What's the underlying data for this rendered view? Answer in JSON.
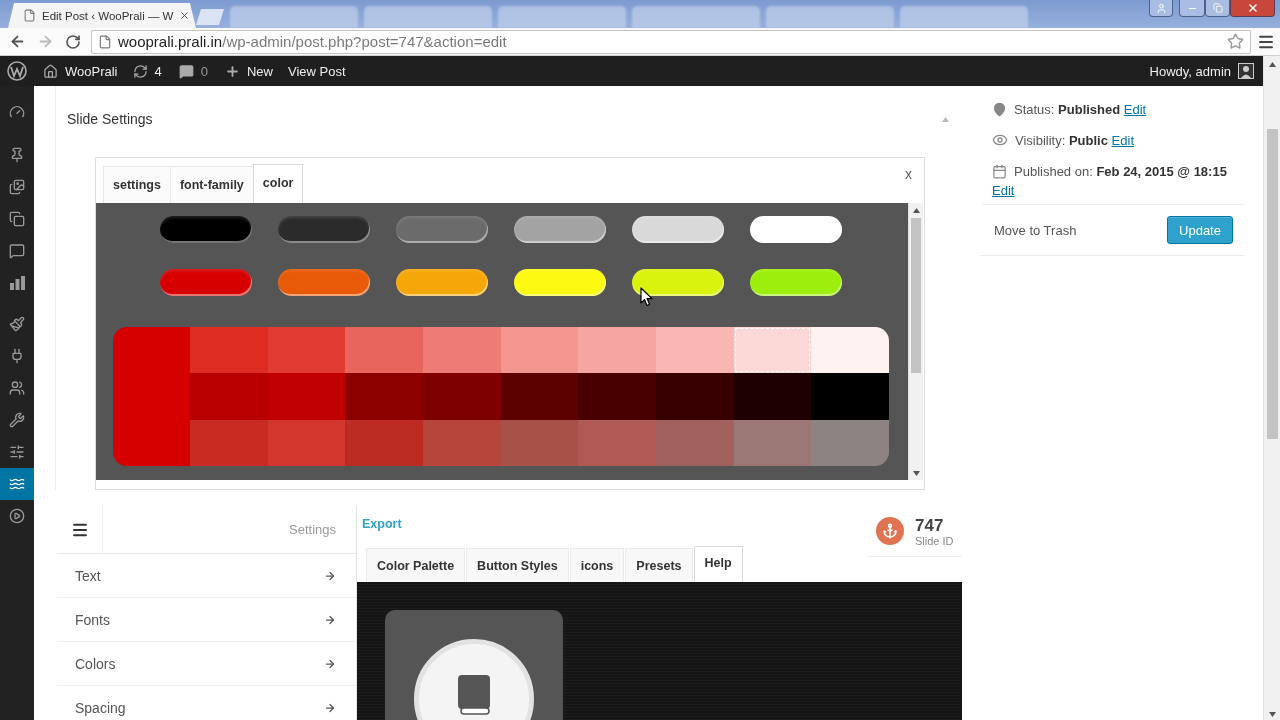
{
  "browser": {
    "tabs": [
      {
        "title": "Edit Post ‹ WooPrali — W",
        "selected": true
      },
      {
        "selected": false
      },
      {
        "selected": false
      },
      {
        "selected": false
      },
      {
        "selected": false
      },
      {
        "selected": false
      },
      {
        "selected": false
      }
    ],
    "address": {
      "host": "wooprali.prali.in",
      "path": "/wp-admin/post.php?post=747&action=edit"
    }
  },
  "admin_bar": {
    "site": "WooPrali",
    "updates": "4",
    "comments": "0",
    "new": "New",
    "view_post": "View Post",
    "greeting": "Howdy, admin"
  },
  "admin_menu": [
    {
      "selected": false
    },
    {
      "selected": false
    },
    {
      "selected": false
    },
    {
      "selected": false
    },
    {
      "selected": false
    },
    {
      "selected": false
    },
    {
      "selected": false
    },
    {
      "selected": false
    },
    {
      "selected": false
    },
    {
      "selected": false
    },
    {
      "selected": false
    },
    {
      "selected": true
    },
    {
      "selected": false
    }
  ],
  "slide_settings": {
    "title": "Slide Settings",
    "tabs": [
      {
        "label": "settings",
        "selected": false
      },
      {
        "label": "font-family",
        "selected": false
      },
      {
        "label": "color",
        "selected": true
      }
    ],
    "close": "x",
    "pill_rows": [
      {
        "swatches": [
          {
            "color": "#000000"
          },
          {
            "color": "#2b2b2b"
          },
          {
            "color": "#6b6b6b"
          },
          {
            "color": "#a3a3a3"
          },
          {
            "color": "#d9d9d9"
          },
          {
            "color": "#ffffff"
          }
        ]
      },
      {
        "swatches": [
          {
            "color": "#d60000"
          },
          {
            "color": "#e85a08"
          },
          {
            "color": "#f5a70a"
          },
          {
            "color": "#fdf912"
          },
          {
            "color": "#d9f30e"
          },
          {
            "color": "#9cee0c"
          }
        ]
      }
    ],
    "shades": {
      "base": {
        "color": "#d60000"
      },
      "rows": [
        {
          "swatches": [
            {
              "color": "#df2c22",
              "selected": false
            },
            {
              "color": "#e23b32",
              "selected": false
            },
            {
              "color": "#e8655d",
              "selected": false
            },
            {
              "color": "#ec7c75",
              "selected": false
            },
            {
              "color": "#f39690",
              "selected": false
            },
            {
              "color": "#f6a6a2",
              "selected": false
            },
            {
              "color": "#f9b6b2",
              "selected": false
            },
            {
              "color": "#fcd8d6",
              "selected": true
            },
            {
              "color": "#fff3f2",
              "selected": false
            }
          ]
        },
        {
          "swatches": [
            {
              "color": "#b80000",
              "selected": false
            },
            {
              "color": "#c00000",
              "selected": false
            },
            {
              "color": "#8c0000",
              "selected": false
            },
            {
              "color": "#7e0000",
              "selected": false
            },
            {
              "color": "#5c0000",
              "selected": false
            },
            {
              "color": "#480000",
              "selected": false
            },
            {
              "color": "#380000",
              "selected": false
            },
            {
              "color": "#1e0000",
              "selected": false
            },
            {
              "color": "#000000",
              "selected": false
            }
          ]
        },
        {
          "swatches": [
            {
              "color": "#c92a21",
              "selected": false
            },
            {
              "color": "#d2362c",
              "selected": false
            },
            {
              "color": "#bd2c22",
              "selected": false
            },
            {
              "color": "#b6453b",
              "selected": false
            },
            {
              "color": "#a85149",
              "selected": false
            },
            {
              "color": "#b15a54",
              "selected": false
            },
            {
              "color": "#a2605d",
              "selected": false
            },
            {
              "color": "#9b7775",
              "selected": false
            },
            {
              "color": "#8e8383",
              "selected": false
            }
          ]
        }
      ]
    }
  },
  "publish": {
    "meta": [
      {
        "text": "Status: **Published**",
        "link": "Edit"
      },
      {
        "text": "Visibility: **Public**",
        "link": "Edit"
      },
      {
        "text": "Published on: **Feb 24, 2015 @ 18:15**",
        "link": "Edit"
      }
    ],
    "trash": "Move to Trash",
    "update": "Update"
  },
  "builder": {
    "menu_title": "Settings",
    "menu": [
      {
        "label": "Text"
      },
      {
        "label": "Fonts"
      },
      {
        "label": "Colors"
      },
      {
        "label": "Spacing"
      }
    ],
    "export": "Export",
    "slide_id": {
      "value": "747",
      "label": "Slide ID"
    },
    "tabs": [
      {
        "label": "Color Palette",
        "selected": false
      },
      {
        "label": "Button Styles",
        "selected": false
      },
      {
        "label": "icons",
        "selected": false
      },
      {
        "label": "Presets",
        "selected": false
      },
      {
        "label": "Help",
        "selected": true
      }
    ]
  }
}
